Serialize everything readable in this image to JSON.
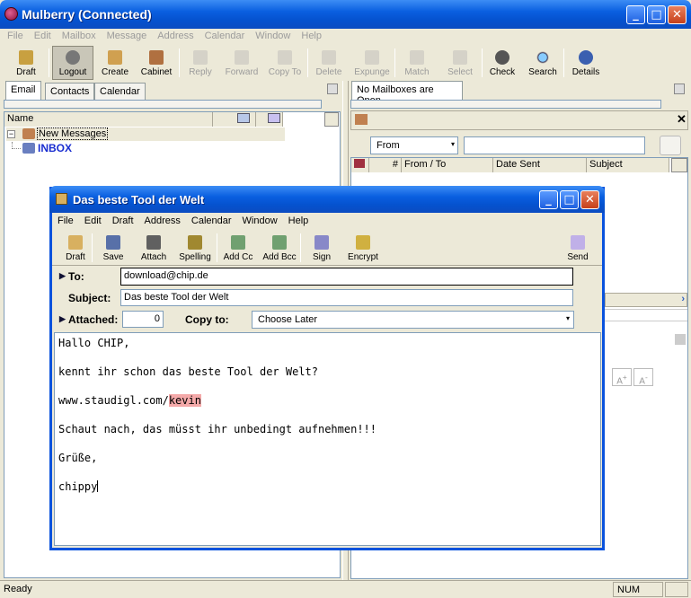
{
  "app": {
    "title": "Mulberry (Connected)",
    "menu": [
      "File",
      "Edit",
      "Mailbox",
      "Message",
      "Address",
      "Calendar",
      "Window",
      "Help"
    ],
    "toolbar": [
      {
        "label": "Draft",
        "icon": "draft-icon",
        "enabled": true
      },
      {
        "label": "Logout",
        "icon": "logout-icon",
        "enabled": true
      },
      {
        "label": "Create",
        "icon": "create-icon",
        "enabled": true
      },
      {
        "label": "Cabinet",
        "icon": "cabinet-icon",
        "enabled": true
      },
      {
        "label": "Reply",
        "icon": "reply-icon",
        "enabled": false
      },
      {
        "label": "Forward",
        "icon": "forward-icon",
        "enabled": false
      },
      {
        "label": "Copy To",
        "icon": "copy-to-icon",
        "enabled": false
      },
      {
        "label": "Delete",
        "icon": "delete-icon",
        "enabled": false
      },
      {
        "label": "Expunge",
        "icon": "expunge-icon",
        "enabled": false
      },
      {
        "label": "Match",
        "icon": "match-icon",
        "enabled": false
      },
      {
        "label": "Select",
        "icon": "select-icon",
        "enabled": false
      },
      {
        "label": "Check",
        "icon": "check-icon",
        "enabled": true
      },
      {
        "label": "Search",
        "icon": "search-icon",
        "enabled": true
      },
      {
        "label": "Details",
        "icon": "details-icon",
        "enabled": true
      }
    ]
  },
  "left_panel": {
    "tabs": [
      "Email",
      "Contacts",
      "Calendar"
    ],
    "column_name": "Name",
    "tree": [
      {
        "label": "New Messages"
      },
      {
        "label": "INBOX"
      }
    ]
  },
  "right_panel": {
    "tab": "No Mailboxes are Open",
    "filter_field": "From",
    "columns": [
      "#",
      "From / To",
      "Date Sent",
      "Subject"
    ]
  },
  "compose": {
    "title": "Das beste Tool der Welt",
    "menu": [
      "File",
      "Edit",
      "Draft",
      "Address",
      "Calendar",
      "Window",
      "Help"
    ],
    "toolbar": [
      {
        "label": "Draft",
        "icon": "draft-icon"
      },
      {
        "label": "Save",
        "icon": "save-icon"
      },
      {
        "label": "Attach",
        "icon": "attach-icon"
      },
      {
        "label": "Spelling",
        "icon": "spelling-icon"
      },
      {
        "label": "Add Cc",
        "icon": "add-cc-icon"
      },
      {
        "label": "Add Bcc",
        "icon": "add-bcc-icon"
      },
      {
        "label": "Sign",
        "icon": "sign-icon"
      },
      {
        "label": "Encrypt",
        "icon": "encrypt-icon"
      },
      {
        "label": "Send",
        "icon": "send-icon"
      }
    ],
    "to_label": "To:",
    "to_value": "download@chip.de",
    "subject_label": "Subject:",
    "subject_value": "Das beste Tool der Welt",
    "attached_label": "Attached:",
    "attached_count": "0",
    "copy_to_label": "Copy to:",
    "copy_to_value": "Choose Later",
    "body_lines": [
      "Hallo CHIP,",
      "kennt ihr schon das beste Tool der Welt?",
      "www.staudigl.com/",
      "Schaut nach, das müsst ihr unbedingt aufnehmen!!!",
      "Grüße,",
      "chippy"
    ],
    "misspelled_word": "kevin"
  },
  "status": {
    "left": "Ready",
    "right": "NUM"
  }
}
